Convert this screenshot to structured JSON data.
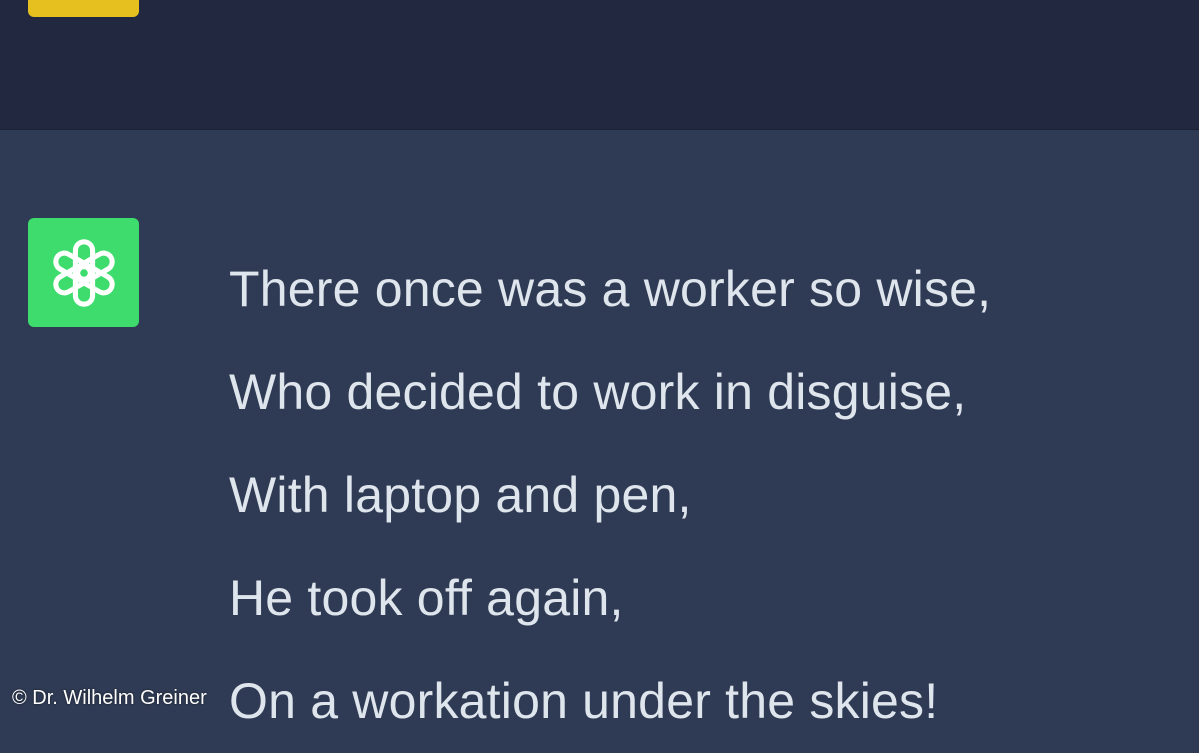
{
  "conversation": {
    "user_message": {
      "avatar_color": "#e6c01f"
    },
    "assistant_message": {
      "avatar_color": "#3ddc6d",
      "avatar_icon": "openai-logo-icon",
      "lines": [
        "There once was a worker so wise,",
        "Who decided to work in disguise,",
        "With laptop and pen,",
        "He took off again,",
        "On a workation under the skies!"
      ]
    }
  },
  "watermark": {
    "credit": "© Dr. Wilhelm Greiner"
  },
  "colors": {
    "user_row_background": "#222840",
    "assistant_row_background": "#2f3b54",
    "text": "#dfe5ec"
  }
}
